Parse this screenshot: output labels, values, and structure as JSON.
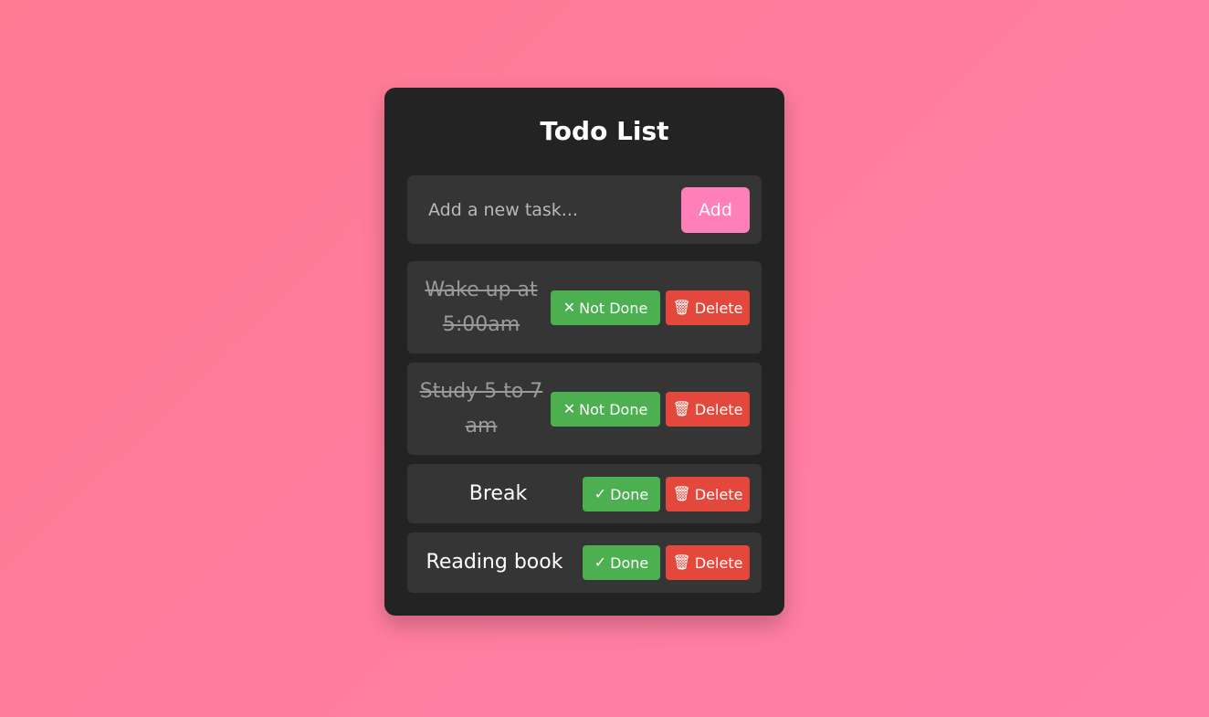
{
  "app": {
    "title": "Todo List"
  },
  "input": {
    "placeholder": "Add a new task...",
    "value": "",
    "add_label": "Add"
  },
  "tasks": [
    {
      "text": "Wake up at 5:00am",
      "completed": true,
      "toggle_label": "Not Done",
      "toggle_icon": "✕",
      "delete_label": "Delete",
      "delete_icon": "🗑"
    },
    {
      "text": "Study 5 to 7 am",
      "completed": true,
      "toggle_label": "Not Done",
      "toggle_icon": "✕",
      "delete_label": "Delete",
      "delete_icon": "🗑"
    },
    {
      "text": "Break",
      "completed": false,
      "toggle_label": "Done",
      "toggle_icon": "✓",
      "delete_label": "Delete",
      "delete_icon": "🗑"
    },
    {
      "text": "Reading book",
      "completed": false,
      "toggle_label": "Done",
      "toggle_icon": "✓",
      "delete_label": "Delete",
      "delete_icon": "🗑"
    }
  ],
  "colors": {
    "accent": "#ff7fb8",
    "done_button": "#4caf50",
    "delete_button": "#e4473b",
    "card_bg": "#232323",
    "row_bg": "#353535"
  }
}
